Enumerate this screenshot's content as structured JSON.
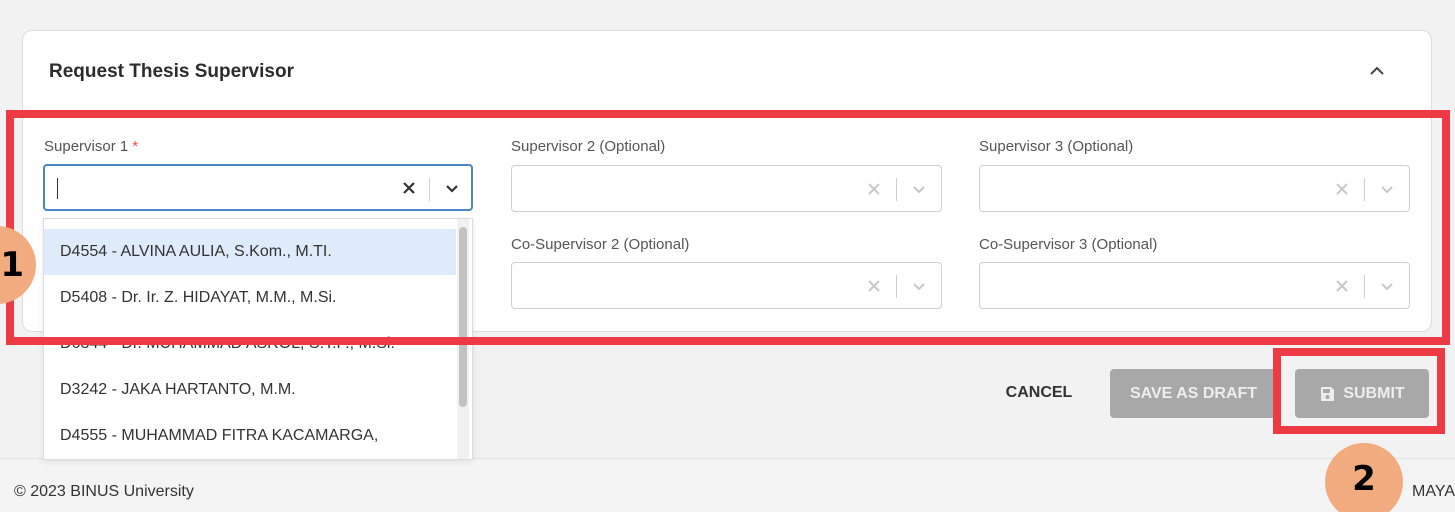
{
  "panel": {
    "title": "Request Thesis Supervisor"
  },
  "fields": {
    "supervisor1": {
      "label": "Supervisor 1",
      "required_mark": "*",
      "value": ""
    },
    "supervisor2": {
      "label": "Supervisor 2 (Optional)",
      "value": ""
    },
    "supervisor3": {
      "label": "Supervisor 3 (Optional)",
      "value": ""
    },
    "cosupervisor2": {
      "label": "Co-Supervisor 2 (Optional)",
      "value": ""
    },
    "cosupervisor3": {
      "label": "Co-Supervisor 3 (Optional)",
      "value": ""
    }
  },
  "dropdown": {
    "options": [
      "D4554 - ALVINA AULIA, S.Kom., M.TI.",
      "D5408 - Dr. Ir. Z. HIDAYAT, M.M., M.Si.",
      "D6344 - Dr. MUHAMMAD ASROL, S.T.P., M.Si.",
      "D3242 - JAKA HARTANTO, M.M.",
      "D4555 - MUHAMMAD FITRA KACAMARGA,"
    ],
    "highlighted": "D4554 - ALVINA AULIA, S.Kom., M.TI."
  },
  "actions": {
    "cancel": "CANCEL",
    "save_draft": "SAVE AS DRAFT",
    "submit": "SUBMIT"
  },
  "annotations": {
    "step1": "1",
    "step2": "2"
  },
  "footer": {
    "copyright": "© 2023 BINUS University",
    "brand_partial": "MAYA"
  },
  "colors": {
    "annotation_red": "#ee3a44",
    "annotation_circle": "#f2ab7e",
    "focus_blue": "#4a86c5",
    "option_highlight": "#deebfb",
    "disabled_button": "#a8a8a8"
  }
}
